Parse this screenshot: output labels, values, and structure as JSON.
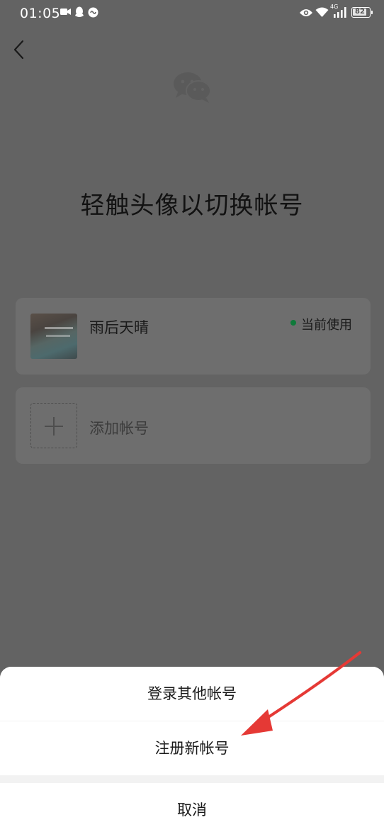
{
  "status_bar": {
    "time": "01:05",
    "network": "4G",
    "battery": "82"
  },
  "page": {
    "title": "轻触头像以切换帐号"
  },
  "accounts": [
    {
      "name": "雨后天晴",
      "status": "当前使用"
    }
  ],
  "add_account": {
    "label": "添加帐号"
  },
  "action_sheet": {
    "login_other": "登录其他帐号",
    "register_new": "注册新帐号",
    "cancel": "取消"
  },
  "colors": {
    "overlay_bg": "#636363",
    "active_dot": "#0f7a3a",
    "arrow": "#e53935"
  },
  "icons": {
    "back": "chevron-left-icon",
    "logo": "wechat-logo-icon",
    "add": "plus-icon"
  }
}
